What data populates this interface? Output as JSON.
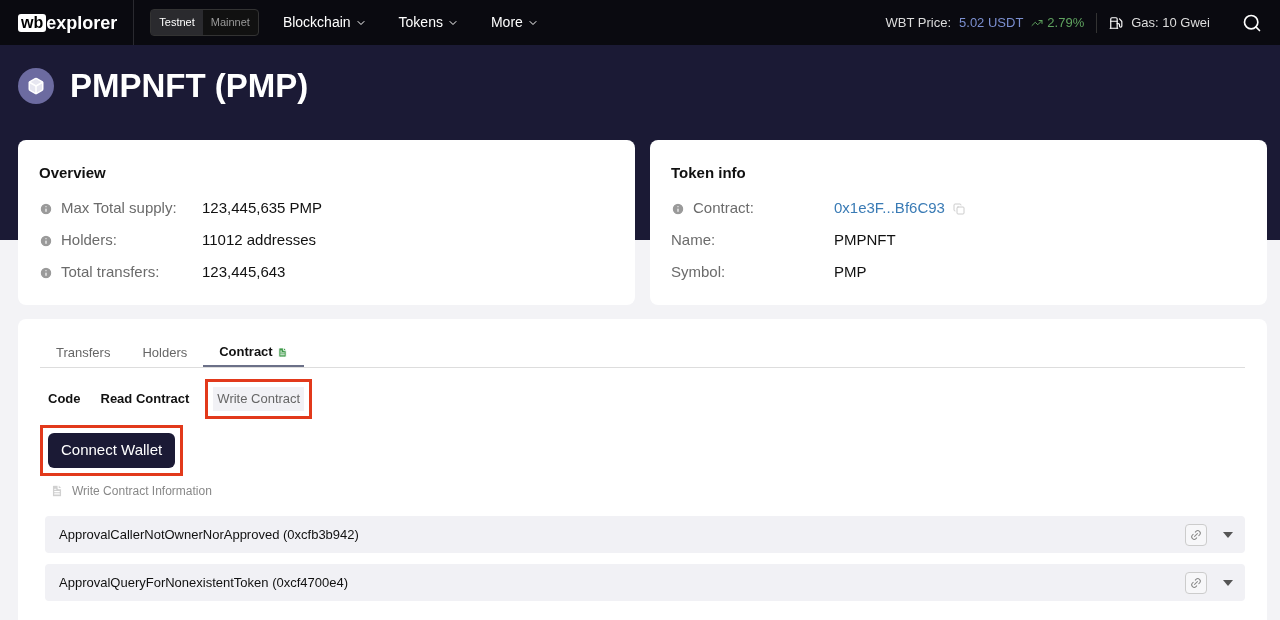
{
  "nav": {
    "logo": {
      "mark": "wb",
      "text": "explorer"
    },
    "networks": [
      {
        "label": "Testnet",
        "selected": true
      },
      {
        "label": "Mainnet",
        "selected": false
      }
    ],
    "menus": [
      "Blockchain",
      "Tokens",
      "More"
    ],
    "price": {
      "label": "WBT Price:",
      "value": "5.02 USDT",
      "change": "2.79%"
    },
    "gas": "Gas: 10 Gwei"
  },
  "token": {
    "title": "PMPNFT (PMP)"
  },
  "overview": {
    "title": "Overview",
    "rows": [
      {
        "label": "Max Total supply:",
        "value": "123,445,635 PMP",
        "info": true
      },
      {
        "label": "Holders:",
        "value": "11012 addresses",
        "info": true
      },
      {
        "label": "Total transfers:",
        "value": "123,445,643",
        "info": true
      }
    ]
  },
  "token_info": {
    "title": "Token info",
    "rows": [
      {
        "label": "Contract:",
        "value": "0x1e3F...Bf6C93",
        "info": true,
        "kind": "link"
      },
      {
        "label": "Name:",
        "value": "PMPNFT",
        "info": false,
        "kind": "text"
      },
      {
        "label": "Symbol:",
        "value": "PMP",
        "info": false,
        "kind": "text"
      }
    ]
  },
  "tabs": [
    {
      "label": "Transfers",
      "selected": false
    },
    {
      "label": "Holders",
      "selected": false
    },
    {
      "label": "Contract",
      "selected": true
    }
  ],
  "subtabs": [
    {
      "label": "Code",
      "selected": false
    },
    {
      "label": "Read Contract",
      "selected": false
    },
    {
      "label": "Write Contract",
      "selected": true,
      "highlighted": true
    }
  ],
  "connect_button": {
    "label": "Connect Wallet",
    "highlighted": true
  },
  "info_note": "Write Contract Information",
  "methods": [
    {
      "name": "ApprovalCallerNotOwnerNorApproved (0xcfb3b942)",
      "expanded": false
    },
    {
      "name": "ApprovalQueryForNonexistentToken (0xcf4700e4)",
      "expanded": false
    }
  ]
}
